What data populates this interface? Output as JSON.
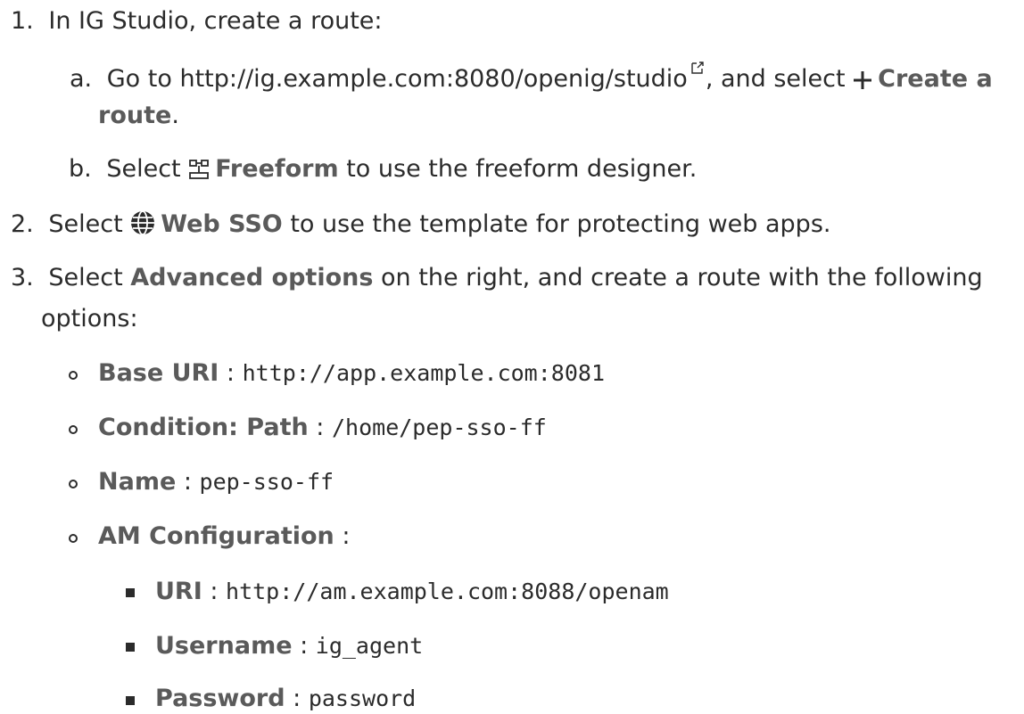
{
  "steps": [
    {
      "num": "1.",
      "text": "In IG Studio, create a route:",
      "substeps": [
        {
          "letter": "a.",
          "pre": "Go to ",
          "link": "http://ig.example.com:8080/openig/studio",
          "mid": ", and select ",
          "bold1": "Create a",
          "bold2": "route",
          "end": ".",
          "icons": [
            "external-link-icon",
            "plus-icon"
          ]
        },
        {
          "letter": "b.",
          "pre": "Select ",
          "bold": "Freeform",
          "post": " to use the freeform designer.",
          "icon": "freeform-icon"
        }
      ]
    },
    {
      "num": "2.",
      "pre": "Select ",
      "bold": "Web SSO",
      "post": " to use the template for protecting web apps.",
      "icon": "globe-icon"
    },
    {
      "num": "3.",
      "pre": "Select ",
      "bold": "Advanced options",
      "post": " on the right, and create a route with the following",
      "cont": "options:",
      "options": [
        {
          "label": "Base URI",
          "sep": " : ",
          "value": "http://app.example.com:8081"
        },
        {
          "label": "Condition: Path",
          "sep": " : ",
          "value": "/home/pep-sso-ff"
        },
        {
          "label": "Name",
          "sep": " : ",
          "value": "pep-sso-ff"
        },
        {
          "label": "AM Configuration",
          "sep": " :",
          "value": ""
        }
      ],
      "am_options": [
        {
          "label": "URI",
          "sep": " : ",
          "value": "http://am.example.com:8088/openam"
        },
        {
          "label": "Username",
          "sep": " : ",
          "value": "ig_agent"
        },
        {
          "label": "Password",
          "sep": " : ",
          "value": "password"
        }
      ]
    }
  ],
  "colors": {
    "text": "#2b2b2b",
    "bold": "#5a5a5a",
    "background": "#ffffff"
  }
}
